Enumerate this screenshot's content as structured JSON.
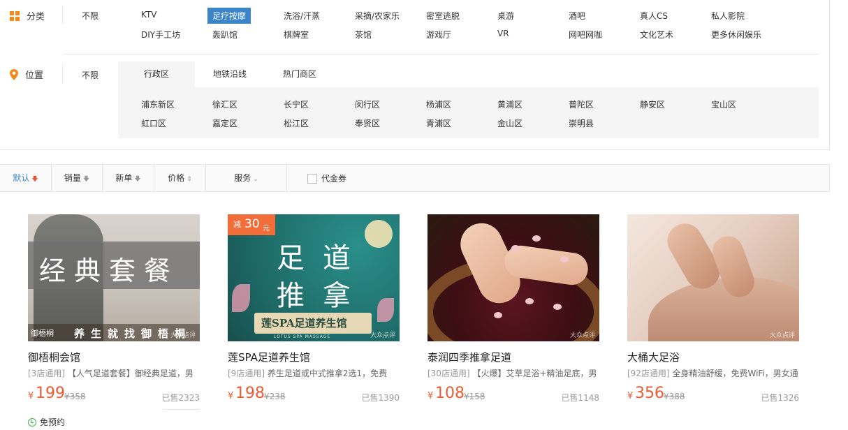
{
  "filters": {
    "category": {
      "label": "分类",
      "unlimited": "不限",
      "items": [
        "KTV",
        "足疗按摩",
        "洗浴/汗蒸",
        "采摘/农家乐",
        "密室逃脱",
        "桌游",
        "酒吧",
        "真人CS",
        "私人影院",
        "DIY手工坊",
        "轰趴馆",
        "棋牌室",
        "茶馆",
        "游戏厅",
        "VR",
        "网吧网咖",
        "文化艺术",
        "更多休闲娱乐"
      ],
      "active": "足疗按摩"
    },
    "location": {
      "label": "位置",
      "unlimited": "不限",
      "tabs": [
        "行政区",
        "地铁沿线",
        "热门商区"
      ],
      "active_tab": "行政区",
      "districts": [
        "浦东新区",
        "徐汇区",
        "长宁区",
        "闵行区",
        "杨浦区",
        "黄浦区",
        "普陀区",
        "静安区",
        "宝山区",
        "虹口区",
        "嘉定区",
        "松江区",
        "奉贤区",
        "青浦区",
        "金山区",
        "崇明县"
      ]
    }
  },
  "sort_bar": {
    "items": [
      {
        "label": "默认",
        "arrow": "🡇",
        "active": true
      },
      {
        "label": "销量",
        "arrow": "🡇",
        "active": false
      },
      {
        "label": "新单",
        "arrow": "🡇",
        "active": false
      },
      {
        "label": "价格",
        "arrow": "⇕",
        "active": false
      },
      {
        "label": "服务",
        "arrow": "⌄",
        "active": false
      }
    ],
    "coupon_label": "代金券"
  },
  "cards": [
    {
      "title": "御梧桐会馆",
      "desc_prefix": "[3店通用]",
      "desc": "【人气足道套餐】御经典足道，男",
      "currency": "¥",
      "price": "199",
      "original": "¥358",
      "sold": "已售2323",
      "booking": "免预约",
      "image_text": {
        "band": "经典套餐",
        "bottom": "养生就找御梧桐",
        "logo": "御梧桐",
        "watermark": "大众点评"
      }
    },
    {
      "title": "莲SPA足道养生馆",
      "desc_prefix": "[9店通用]",
      "desc": "养生足道或中式推拿2选1，免费",
      "currency": "¥",
      "price": "198",
      "original": "¥238",
      "sold": "已售1390",
      "image_text": {
        "badge_small": "减",
        "badge_num": "30",
        "badge_unit": "元",
        "char1": "足",
        "char2": "道",
        "char3": "推",
        "char4": "拿",
        "banner": "莲SPA足道养生馆",
        "sub": "LOTUS SPA MASSAGE",
        "watermark": "大众点评"
      }
    },
    {
      "title": "泰润四季推拿足道",
      "desc_prefix": "[30店通用]",
      "desc": "【火爆】艾草足浴+精油足底，男",
      "currency": "¥",
      "price": "108",
      "original": "¥158",
      "sold": "已售1148",
      "image_text": {
        "watermark": "大众点评"
      }
    },
    {
      "title": "大桶大足浴",
      "desc_prefix": "[92店通用]",
      "desc": "全身精油舒缓，免费WiFi，男女通",
      "currency": "¥",
      "price": "356",
      "original": "¥388",
      "sold": "已售1326",
      "image_text": {
        "watermark": "大众点评"
      }
    }
  ],
  "colors": {
    "accent": "#3a85c9",
    "price": "#ee5a33",
    "icon": "#f08a1a",
    "badge": "#f16e3a",
    "booking": "#3cb34a"
  }
}
